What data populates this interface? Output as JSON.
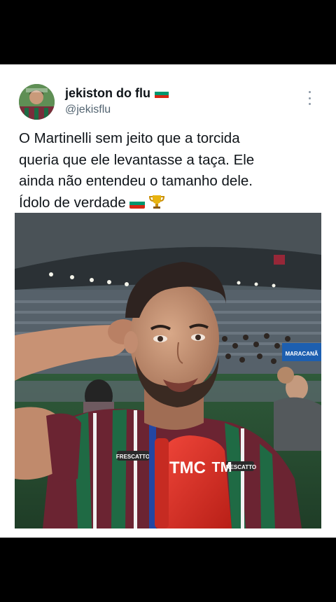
{
  "post": {
    "display_name": "jekiston do flu",
    "handle": "@jekisflu",
    "text_lines": [
      "O Martinelli sem jeito que a torcida",
      "queria que ele levantasse a taça. Ele",
      "ainda não entendeu o tamanho dele.",
      "Ídolo de verdade"
    ],
    "name_emoji": "bulgaria-flag",
    "text_emojis": [
      "bulgaria-flag",
      "trophy"
    ]
  },
  "media": {
    "microphone_text": "TMC",
    "microphone_text_2": "TM",
    "shirt_sponsor_left": "FRESCATTO",
    "shirt_sponsor_right": "FRESCATTO",
    "stadium_sign": "MARACANÃ"
  },
  "colors": {
    "background": "#000000",
    "card": "#ffffff",
    "text": "#0f1419",
    "secondary": "#536471",
    "mic": "#e63027",
    "flag_white": "#ffffff",
    "flag_green": "#00966e",
    "flag_red": "#d62612"
  }
}
